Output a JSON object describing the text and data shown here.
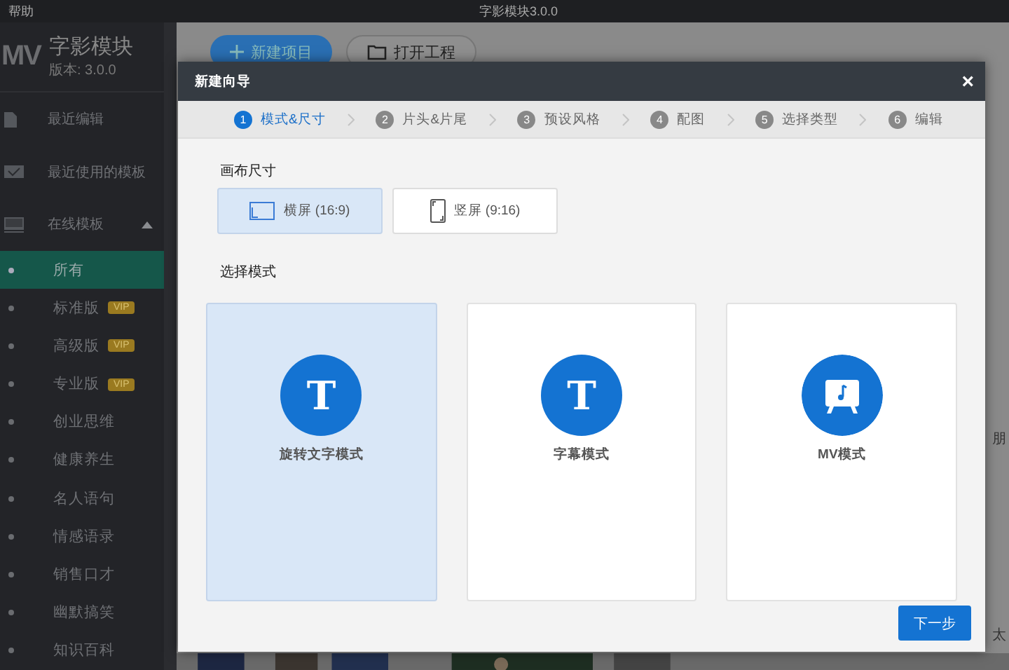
{
  "menu_bar": {
    "help": "帮助",
    "title": "字影模块3.0.0"
  },
  "sidebar": {
    "logo": "MV",
    "app_name": "字影模块",
    "version": "版本: 3.0.0",
    "items": [
      {
        "label": "最近编辑",
        "kind": "file"
      },
      {
        "label": "最近使用的模板",
        "kind": "mail"
      },
      {
        "label": "在线模板",
        "kind": "monitor",
        "expanded": true,
        "children": [
          {
            "label": "所有",
            "selected": true
          },
          {
            "label": "标准版",
            "selected": false,
            "badge": "VIP"
          },
          {
            "label": "高级版",
            "selected": false,
            "badge": "VIP"
          },
          {
            "label": "专业版",
            "selected": false,
            "badge": "VIP"
          },
          {
            "label": "创业思维",
            "selected": false
          },
          {
            "label": "健康养生",
            "selected": false
          },
          {
            "label": "名人语句",
            "selected": false
          },
          {
            "label": "情感语录",
            "selected": false
          },
          {
            "label": "销售口才",
            "selected": false
          },
          {
            "label": "幽默搞笑",
            "selected": false
          },
          {
            "label": "知识百科",
            "selected": false
          }
        ]
      }
    ]
  },
  "toolbar": [
    {
      "label": "新建项目",
      "kind": "primary"
    },
    {
      "label": "打开工程",
      "kind": "folder"
    }
  ],
  "background_labels": [
    "朋",
    "太"
  ],
  "dialog": {
    "title": "新建向导",
    "close": "×",
    "steps": [
      {
        "number": "1",
        "label": "模式&尺寸",
        "selected": true
      },
      {
        "number": "2",
        "label": "片头&片尾",
        "selected": false
      },
      {
        "number": "3",
        "label": "预设风格",
        "selected": false
      },
      {
        "number": "4",
        "label": "配图",
        "selected": false
      },
      {
        "number": "5",
        "label": "选择类型",
        "selected": false
      },
      {
        "number": "6",
        "label": "编辑",
        "selected": false
      }
    ],
    "canvas_heading": "画布尺寸",
    "canvas_options": [
      {
        "label": "横屏 (16:9)",
        "kind": "landscape",
        "selected": true
      },
      {
        "label": "竖屏 (9:16)",
        "kind": "portrait",
        "selected": false
      }
    ],
    "mode_heading": "选择模式",
    "modes": [
      {
        "label": "旋转文字模式",
        "kind": "text",
        "glyph": "T",
        "selected": true
      },
      {
        "label": "字幕模式",
        "kind": "text",
        "glyph": "T",
        "selected": false
      },
      {
        "label": "MV模式",
        "kind": "mv",
        "selected": false
      }
    ],
    "next_button": "下一步"
  }
}
